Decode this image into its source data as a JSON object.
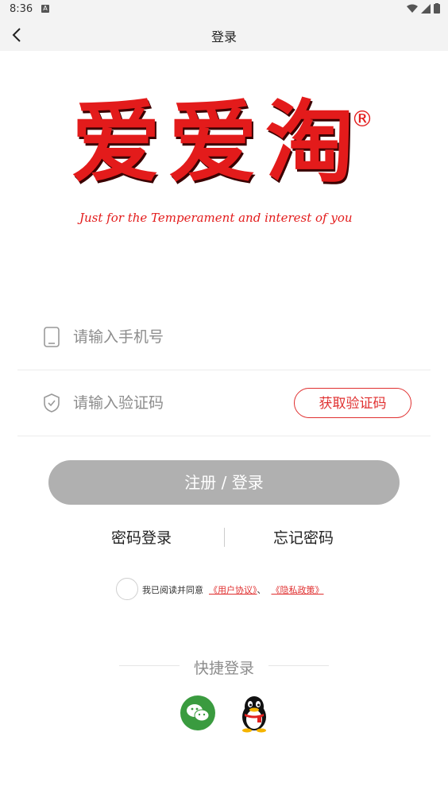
{
  "status_bar": {
    "time": "8:36"
  },
  "app_bar": {
    "title": "登录"
  },
  "logo": {
    "main_text": "爱爱淘",
    "reg_mark": "®",
    "tagline": "Just for the Temperament and interest of you"
  },
  "phone_field": {
    "placeholder": "请输入手机号",
    "value": ""
  },
  "code_field": {
    "placeholder": "请输入验证码",
    "value": ""
  },
  "get_code_label": "获取验证码",
  "submit_label": "注册 / 登录",
  "links": {
    "password_login": "密码登录",
    "forgot_password": "忘记密码"
  },
  "agreement": {
    "prefix": "我已阅读并同意",
    "user_agreement": "《用户协议》",
    "separator": "、",
    "privacy_policy": "《隐私政策》"
  },
  "quick_login": {
    "label": "快捷登录"
  },
  "colors": {
    "accent": "#e03030",
    "button_disabled": "#b0b0b0",
    "wechat": "#3a9b3f"
  }
}
